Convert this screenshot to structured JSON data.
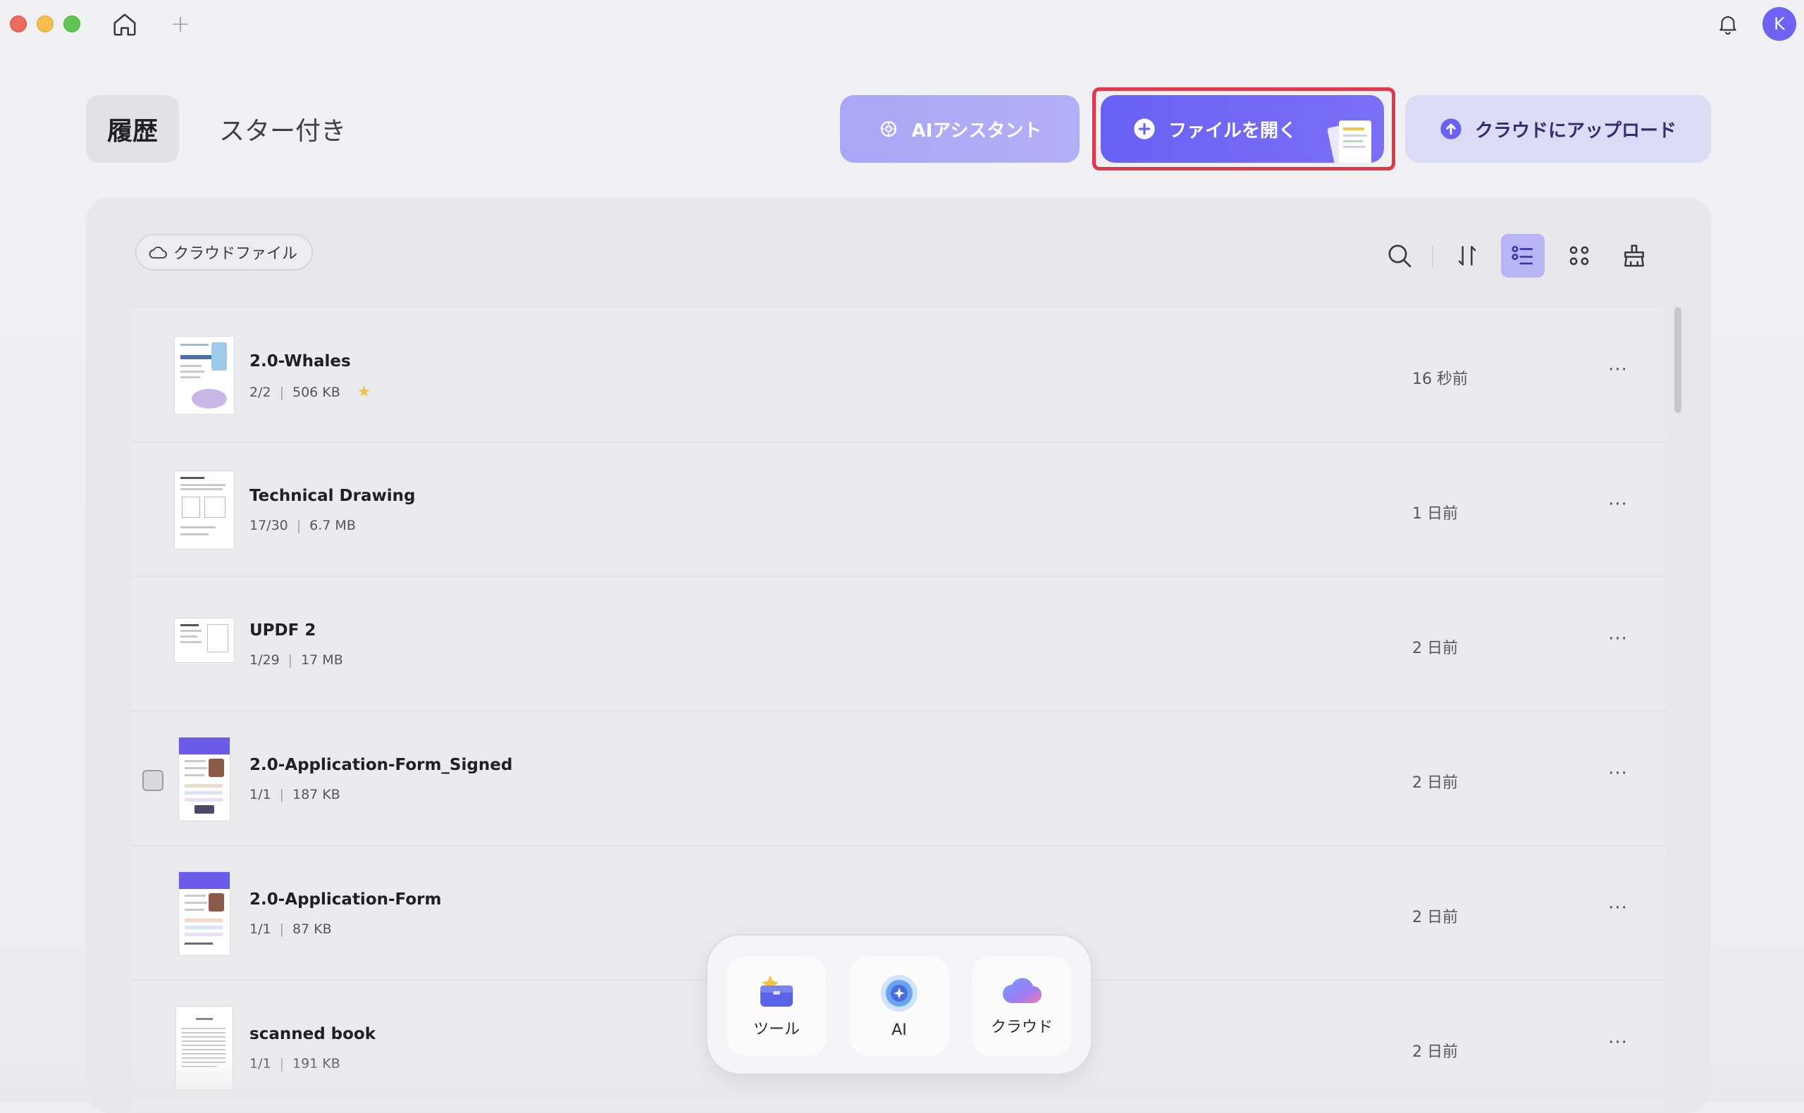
{
  "titlebar": {
    "avatar_initial": "K"
  },
  "tabs": [
    {
      "label": "履歴",
      "active": true
    },
    {
      "label": "スター付き",
      "active": false
    }
  ],
  "actions": {
    "ai_assistant": "AIアシスタント",
    "open_file": "ファイルを開く",
    "upload_cloud": "クラウドにアップロード"
  },
  "panel": {
    "cloud_chip": "クラウドファイル",
    "view_mode": "list"
  },
  "files": [
    {
      "name": "2.0-Whales",
      "pages": "2/2",
      "size": "506 KB",
      "starred": true,
      "time": "16 秒前",
      "more": "···",
      "thumb": "poster"
    },
    {
      "name": "Technical Drawing",
      "pages": "17/30",
      "size": "6.7 MB",
      "starred": false,
      "time": "1 日前",
      "more": "···",
      "thumb": "doc"
    },
    {
      "name": "UPDF 2",
      "pages": "1/29",
      "size": "17 MB",
      "starred": false,
      "time": "2 日前",
      "more": "···",
      "thumb": "landscape"
    },
    {
      "name": "2.0-Application-Form_Signed",
      "pages": "1/1",
      "size": "187 KB",
      "starred": false,
      "time": "2 日前",
      "more": "···",
      "thumb": "form",
      "checkbox": true
    },
    {
      "name": "2.0-Application-Form",
      "pages": "1/1",
      "size": "87 KB",
      "starred": false,
      "time": "2 日前",
      "more": "···",
      "thumb": "form"
    },
    {
      "name": "scanned book",
      "pages": "1/1",
      "size": "191 KB",
      "starred": false,
      "time": "2 日前",
      "more": "···",
      "thumb": "doc"
    }
  ],
  "dock": {
    "tools": "ツール",
    "ai": "AI",
    "cloud": "クラウド"
  },
  "colors": {
    "accent": "#6961f4",
    "highlight": "#e0384a",
    "star": "#f5c342"
  }
}
